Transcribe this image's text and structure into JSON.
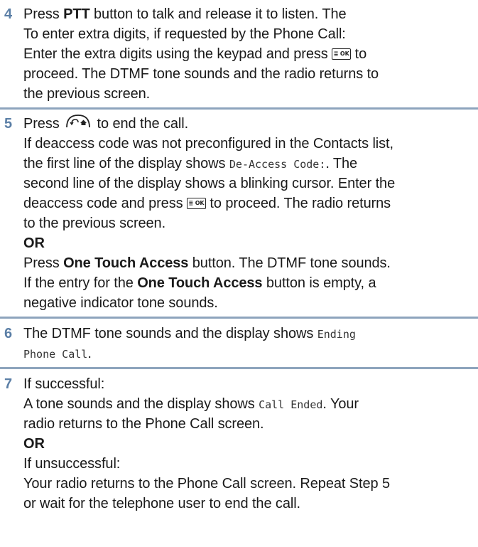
{
  "steps": [
    {
      "number": "4",
      "lines": {
        "l1": {
          "a": "Press ",
          "b": "PTT",
          "c": " button to talk and release it to listen. The"
        },
        "l2": "To enter extra digits, if requested by the Phone Call:",
        "l3": {
          "a": "Enter the extra digits using the keypad and press ",
          "c": " to"
        },
        "l4": "proceed. The DTMF tone sounds and the radio returns to",
        "l5": "the previous screen."
      }
    },
    {
      "number": "5",
      "lines": {
        "l1": {
          "a": "Press ",
          "c": " to end the call."
        },
        "l2": "If deaccess code was not preconfigured in the Contacts list,",
        "l3": {
          "a": "the first line of the display shows ",
          "mono": "De-Access Code:",
          "c": ". The"
        },
        "l4": "second line of the display shows a blinking cursor. Enter the",
        "l5": {
          "a": "deaccess code and press ",
          "c": " to proceed. The radio returns"
        },
        "l6": "to the previous screen.",
        "l7": "OR",
        "l8": {
          "a": "Press ",
          "b": "One Touch Access",
          "c": " button. The DTMF tone sounds."
        },
        "l9": {
          "a": "If the entry for the ",
          "b": "One Touch Access",
          "c": " button is empty, a"
        },
        "l10": "negative indicator tone sounds."
      }
    },
    {
      "number": "6",
      "lines": {
        "l1": {
          "a": "The DTMF tone sounds and the display shows ",
          "mono": "Ending"
        },
        "l2": {
          "mono": "Phone Call",
          "c": "."
        }
      }
    },
    {
      "number": "7",
      "lines": {
        "l1": "If successful:",
        "l2": {
          "a": "A tone sounds and the display shows ",
          "mono": "Call Ended",
          "c": ". Your"
        },
        "l3": "radio returns to the Phone Call screen.",
        "l4": "OR",
        "l5": "If unsuccessful:",
        "l6": "Your radio returns to the Phone Call screen. Repeat Step 5",
        "l7": "or wait for the telephone user to end the call."
      }
    }
  ],
  "icons": {
    "menu_ok_key": "menu-ok-key-icon",
    "back_home_key": "back-home-key-icon",
    "menu_ok_label": "≣ OK"
  },
  "colors": {
    "step_number": "#5b7fa6",
    "separator": "#8da4bd",
    "text": "#1a1a1a"
  }
}
